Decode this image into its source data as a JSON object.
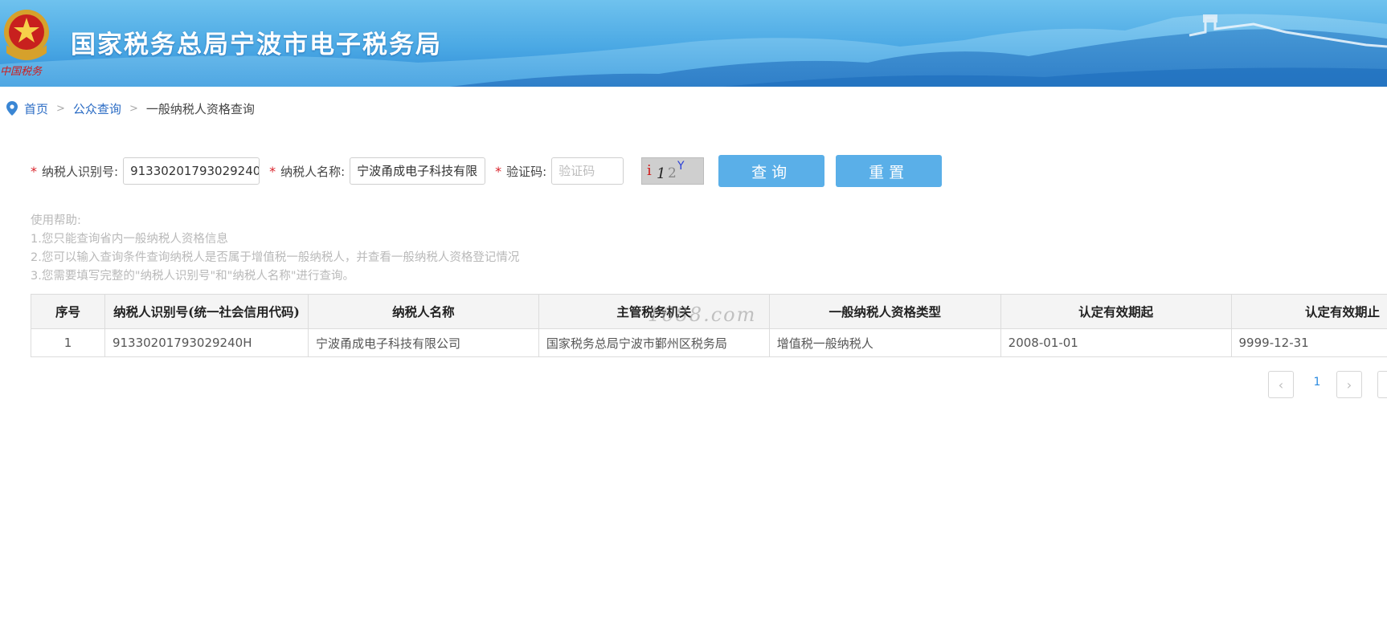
{
  "header": {
    "title": "国家税务总局宁波市电子税务局",
    "emblem_caption": "中国税务"
  },
  "breadcrumb": {
    "home": "首页",
    "sep1": ">",
    "public_query": "公众查询",
    "sep2": ">",
    "current": "一般纳税人资格查询"
  },
  "form": {
    "required_mark": "*",
    "taxpayer_id_label": "纳税人识别号:",
    "taxpayer_id_value": "91330201793029240",
    "taxpayer_name_label": "纳税人名称:",
    "taxpayer_name_value": "宁波甬成电子科技有限",
    "captcha_label": "验证码:",
    "captcha_placeholder": "验证码",
    "captcha_image_text": "i 1 2 Y",
    "query_button": "查询",
    "reset_button": "重置"
  },
  "help": {
    "title": "使用帮助:",
    "lines": [
      "1.您只能查询省内一般纳税人资格信息",
      "2.您可以输入查询条件查询纳税人是否属于增值税一般纳税人，并查看一般纳税人资格登记情况",
      "3.您需要填写完整的\"纳税人识别号\"和\"纳税人名称\"进行查询。"
    ]
  },
  "table": {
    "columns": [
      "序号",
      "纳税人识别号(统一社会信用代码)",
      "纳税人名称",
      "主管税务机关",
      "一般纳税人资格类型",
      "认定有效期起",
      "认定有效期止"
    ],
    "rows": [
      [
        "1",
        "91330201793029240H",
        "宁波甬成电子科技有限公司",
        "国家税务总局宁波市鄞州区税务局",
        "增值税一般纳税人",
        "2008-01-01",
        "9999-12-31"
      ]
    ]
  },
  "watermark": "1688.com",
  "pagination": {
    "prev": "‹",
    "current_page": "1",
    "next": "›"
  },
  "colors": {
    "banner": "#4aa8e4",
    "link": "#2a6bc4",
    "button": "#5aafe8",
    "required": "#d9232b",
    "help_text": "#b9b9b9"
  }
}
